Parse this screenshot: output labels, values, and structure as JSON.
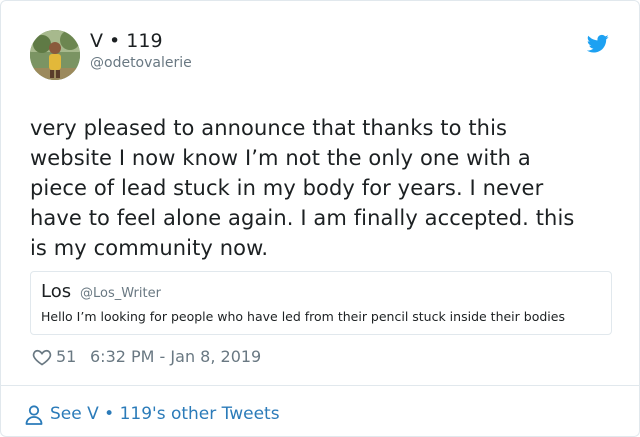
{
  "author": {
    "display_name": "V • 119",
    "handle": "@odetovalerie"
  },
  "tweet": {
    "lines": [
      "very pleased to announce that thanks to this",
      "website I now know I’m not the only one with a",
      "piece of lead stuck in my body for years. I never",
      "have to feel alone again. I am finally accepted. this",
      "is my community now."
    ]
  },
  "quoted_tweet": {
    "name": "Los",
    "handle": "@Los_Writer",
    "text": "Hello I’m looking for people who have led from their pencil stuck inside their bodies"
  },
  "meta": {
    "likes": "51",
    "timestamp": "6:32 PM - Jan 8, 2019"
  },
  "footer": {
    "link_text": "See V • 119's other Tweets"
  },
  "icons": {
    "brand": "twitter-bird-icon",
    "like": "heart-icon",
    "profile": "person-icon"
  },
  "colors": {
    "brand_blue": "#1da1f2",
    "link_blue": "#2b7bb9",
    "secondary_text": "#697882",
    "border": "#e1e8ed"
  }
}
